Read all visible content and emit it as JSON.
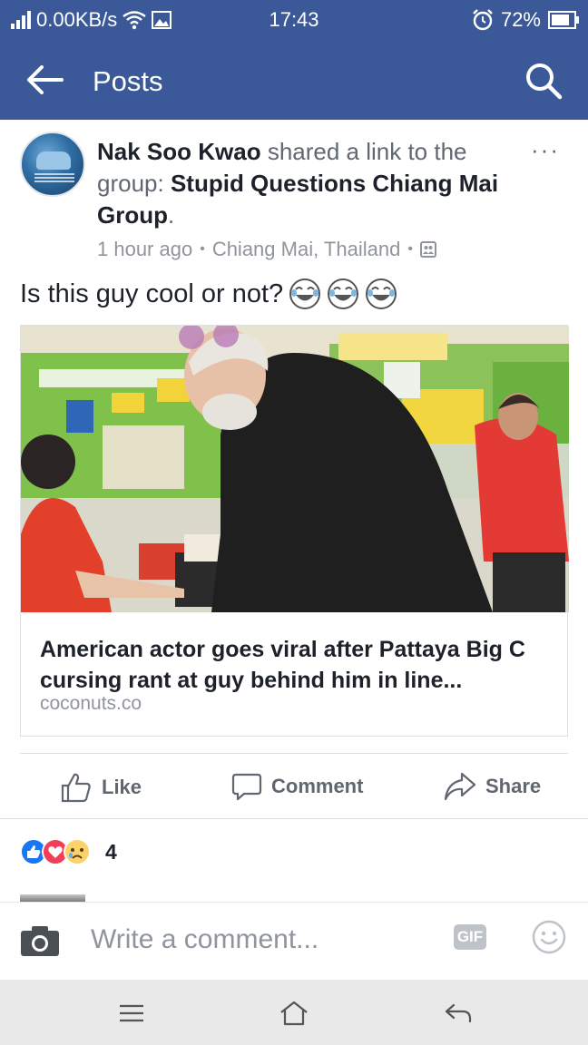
{
  "status_bar": {
    "network_speed": "0.00KB/s",
    "time": "17:43",
    "battery": "72%"
  },
  "app_bar": {
    "title": "Posts"
  },
  "post": {
    "author": "Nak Soo Kwao",
    "action_text": " shared a link to the group: ",
    "group": "Stupid Questions Chiang Mai Group",
    "period": ".",
    "time_ago": "1 hour ago",
    "location": "Chiang Mai, Thailand",
    "separator": "•",
    "more_label": "···",
    "text": "Is this guy cool or not?",
    "link": {
      "title": "American actor goes viral after Pattaya Big C cursing rant at guy behind him in line...",
      "domain": "coconuts.co"
    },
    "actions": {
      "like": "Like",
      "comment": "Comment",
      "share": "Share"
    },
    "reaction_count": "4"
  },
  "comment_bar": {
    "placeholder": "Write a comment...",
    "gif_label": "GIF"
  },
  "colors": {
    "brand": "#3b5998",
    "like_blue": "#1877f2",
    "love_red": "#f33e58",
    "sad_yellow": "#fcd26b"
  }
}
